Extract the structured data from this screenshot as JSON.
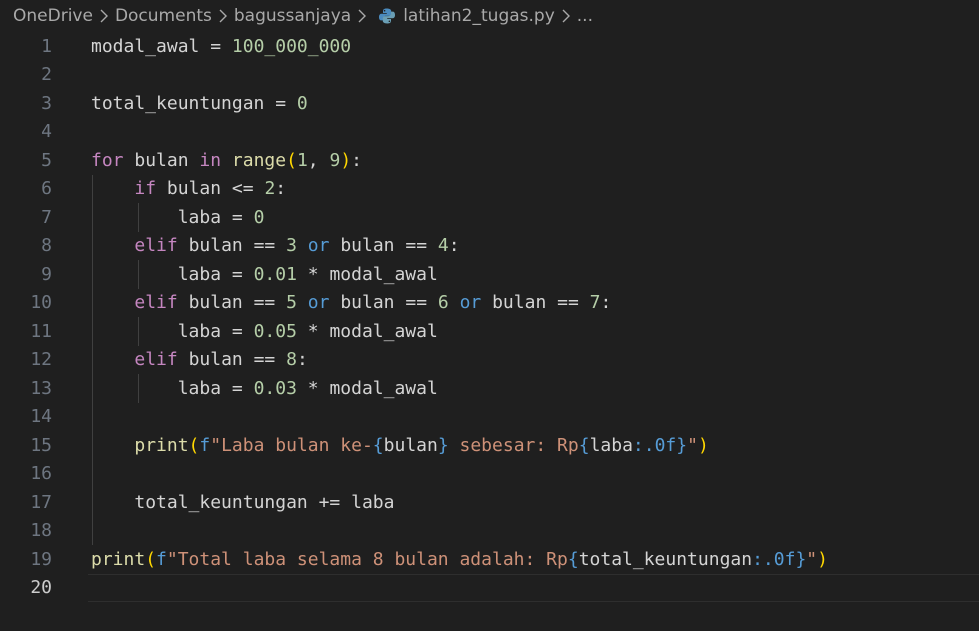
{
  "breadcrumb": {
    "items": [
      "OneDrive",
      "Documents",
      "bagussanjaya",
      "latihan2_tugas.py",
      "..."
    ],
    "file_icon": "python-file-icon"
  },
  "editor": {
    "active_line": 20,
    "line_numbers": [
      "1",
      "2",
      "3",
      "4",
      "5",
      "6",
      "7",
      "8",
      "9",
      "10",
      "11",
      "12",
      "13",
      "14",
      "15",
      "16",
      "17",
      "18",
      "19",
      "20"
    ],
    "lines": [
      [
        [
          "var",
          "modal_awal"
        ],
        [
          "op",
          " = "
        ],
        [
          "num",
          "100_000_000"
        ]
      ],
      [],
      [
        [
          "var",
          "total_keuntungan"
        ],
        [
          "op",
          " = "
        ],
        [
          "num",
          "0"
        ]
      ],
      [],
      [
        [
          "kw",
          "for"
        ],
        [
          "op",
          " "
        ],
        [
          "var",
          "bulan"
        ],
        [
          "op",
          " "
        ],
        [
          "kw",
          "in"
        ],
        [
          "op",
          " "
        ],
        [
          "fn",
          "range"
        ],
        [
          "p1",
          "("
        ],
        [
          "num",
          "1"
        ],
        [
          "op",
          ", "
        ],
        [
          "num",
          "9"
        ],
        [
          "p1",
          ")"
        ],
        [
          "op",
          ":"
        ]
      ],
      [
        [
          "op",
          "    "
        ],
        [
          "kw",
          "if"
        ],
        [
          "op",
          " "
        ],
        [
          "var",
          "bulan"
        ],
        [
          "op",
          " <= "
        ],
        [
          "num",
          "2"
        ],
        [
          "op",
          ":"
        ]
      ],
      [
        [
          "op",
          "        "
        ],
        [
          "var",
          "laba"
        ],
        [
          "op",
          " = "
        ],
        [
          "num",
          "0"
        ]
      ],
      [
        [
          "op",
          "    "
        ],
        [
          "kw",
          "elif"
        ],
        [
          "op",
          " "
        ],
        [
          "var",
          "bulan"
        ],
        [
          "op",
          " == "
        ],
        [
          "num",
          "3"
        ],
        [
          "op",
          " "
        ],
        [
          "kb",
          "or"
        ],
        [
          "op",
          " "
        ],
        [
          "var",
          "bulan"
        ],
        [
          "op",
          " == "
        ],
        [
          "num",
          "4"
        ],
        [
          "op",
          ":"
        ]
      ],
      [
        [
          "op",
          "        "
        ],
        [
          "var",
          "laba"
        ],
        [
          "op",
          " = "
        ],
        [
          "num",
          "0.01"
        ],
        [
          "op",
          " * "
        ],
        [
          "var",
          "modal_awal"
        ]
      ],
      [
        [
          "op",
          "    "
        ],
        [
          "kw",
          "elif"
        ],
        [
          "op",
          " "
        ],
        [
          "var",
          "bulan"
        ],
        [
          "op",
          " == "
        ],
        [
          "num",
          "5"
        ],
        [
          "op",
          " "
        ],
        [
          "kb",
          "or"
        ],
        [
          "op",
          " "
        ],
        [
          "var",
          "bulan"
        ],
        [
          "op",
          " == "
        ],
        [
          "num",
          "6"
        ],
        [
          "op",
          " "
        ],
        [
          "kb",
          "or"
        ],
        [
          "op",
          " "
        ],
        [
          "var",
          "bulan"
        ],
        [
          "op",
          " == "
        ],
        [
          "num",
          "7"
        ],
        [
          "op",
          ":"
        ]
      ],
      [
        [
          "op",
          "        "
        ],
        [
          "var",
          "laba"
        ],
        [
          "op",
          " = "
        ],
        [
          "num",
          "0.05"
        ],
        [
          "op",
          " * "
        ],
        [
          "var",
          "modal_awal"
        ]
      ],
      [
        [
          "op",
          "    "
        ],
        [
          "kw",
          "elif"
        ],
        [
          "op",
          " "
        ],
        [
          "var",
          "bulan"
        ],
        [
          "op",
          " == "
        ],
        [
          "num",
          "8"
        ],
        [
          "op",
          ":"
        ]
      ],
      [
        [
          "op",
          "        "
        ],
        [
          "var",
          "laba"
        ],
        [
          "op",
          " = "
        ],
        [
          "num",
          "0.03"
        ],
        [
          "op",
          " * "
        ],
        [
          "var",
          "modal_awal"
        ]
      ],
      [],
      [
        [
          "op",
          "    "
        ],
        [
          "fn",
          "print"
        ],
        [
          "p1",
          "("
        ],
        [
          "kb",
          "f"
        ],
        [
          "str",
          "\"Laba bulan ke-"
        ],
        [
          "sp",
          "{"
        ],
        [
          "var",
          "bulan"
        ],
        [
          "sp",
          "}"
        ],
        [
          "str",
          " sebesar: Rp"
        ],
        [
          "sp",
          "{"
        ],
        [
          "var",
          "laba"
        ],
        [
          "sp",
          ":.0f"
        ],
        [
          "sp",
          "}"
        ],
        [
          "str",
          "\""
        ],
        [
          "p1",
          ")"
        ]
      ],
      [],
      [
        [
          "op",
          "    "
        ],
        [
          "var",
          "total_keuntungan"
        ],
        [
          "op",
          " += "
        ],
        [
          "var",
          "laba"
        ]
      ],
      [],
      [
        [
          "fn",
          "print"
        ],
        [
          "p1",
          "("
        ],
        [
          "kb",
          "f"
        ],
        [
          "str",
          "\"Total laba selama 8 bulan adalah: Rp"
        ],
        [
          "sp",
          "{"
        ],
        [
          "var",
          "total_keuntungan"
        ],
        [
          "sp",
          ":.0f"
        ],
        [
          "sp",
          "}"
        ],
        [
          "str",
          "\""
        ],
        [
          "p1",
          ")"
        ]
      ],
      []
    ]
  },
  "colors": {
    "background": "#1f1f1f",
    "keyword": "#c586c0",
    "builtin_keyword": "#569cd6",
    "function": "#dcdcaa",
    "number": "#b5cea8",
    "string": "#ce9178",
    "bracket_level1": "#ffd700"
  }
}
